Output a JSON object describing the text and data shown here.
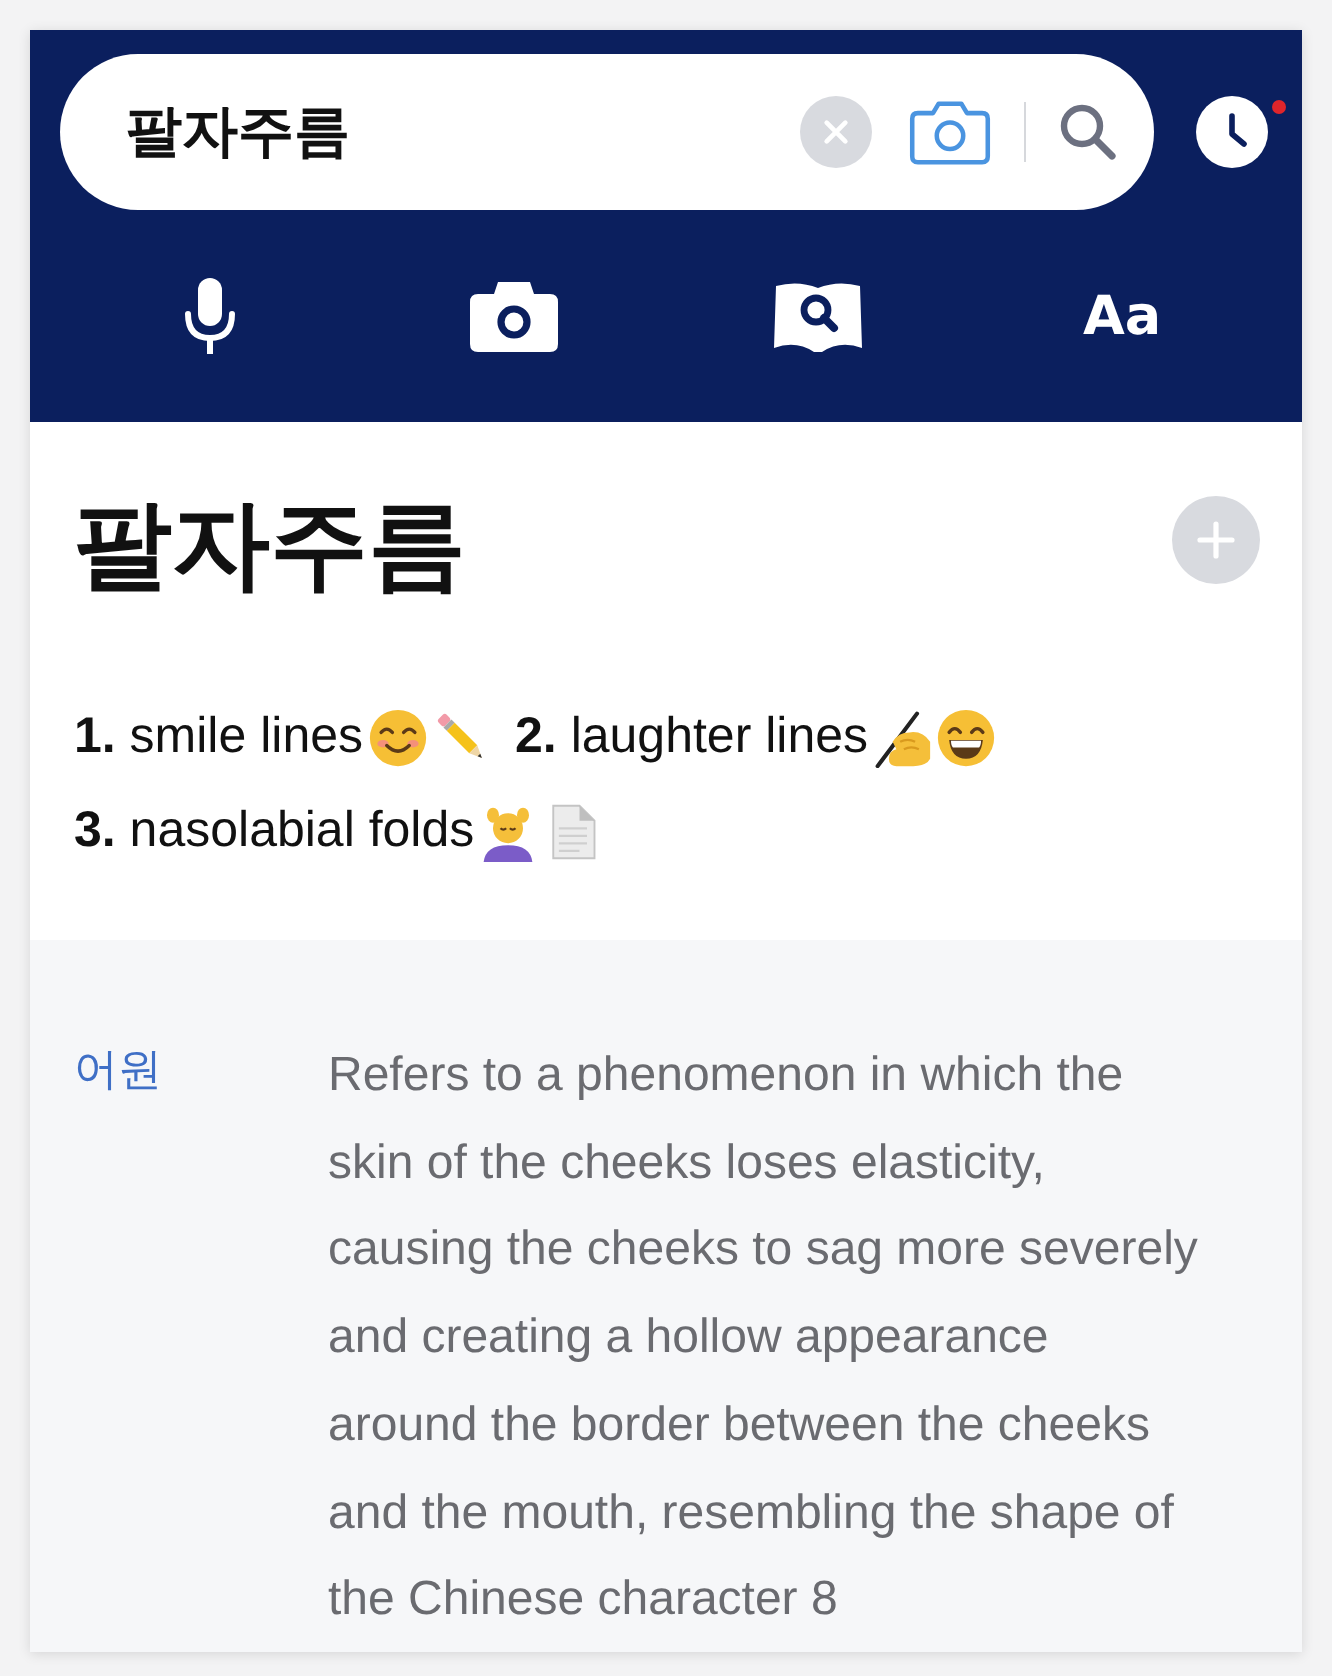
{
  "search": {
    "value": "팔자주름"
  },
  "history": {
    "has_notification": true
  },
  "toolbar": {
    "font_button": "Aa"
  },
  "entry": {
    "headword": "팔자주름",
    "definitions": [
      {
        "number": "1.",
        "text": "smile lines"
      },
      {
        "number": "2.",
        "text": "laughter lines"
      },
      {
        "number": "3.",
        "text": "nasolabial folds"
      }
    ]
  },
  "etymology": {
    "label": "어원",
    "text": "Refers to a phenomenon in which the skin of the cheeks loses elasticity, causing the cheeks to sag more severely and creating a hollow appearance around the border between the cheeks and the mouth, resembling the shape of the Chinese character 8"
  }
}
